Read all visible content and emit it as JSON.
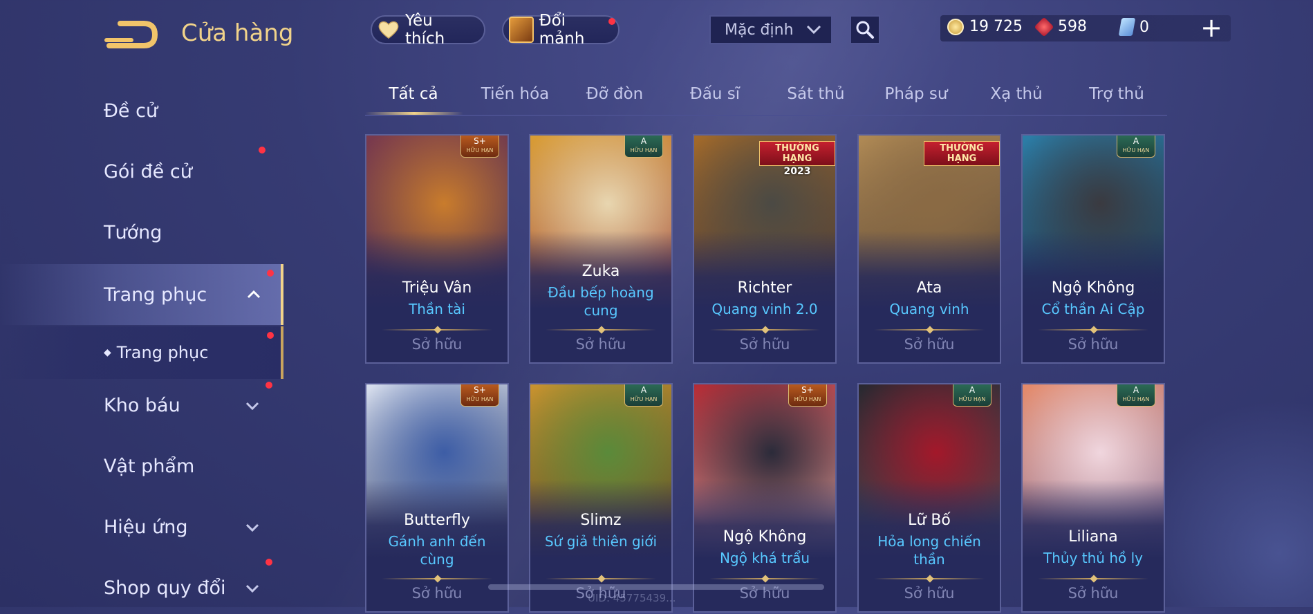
{
  "header": {
    "title": "Cửa hàng",
    "favorite_label": "Yêu thích",
    "exchange_label": "Đổi mảnh",
    "sort": {
      "selected": "Mặc định"
    }
  },
  "currencies": {
    "gold": "19 725",
    "quan_huy": "598",
    "voucher": "0"
  },
  "sidebar": {
    "items": [
      {
        "label": "Đề cử"
      },
      {
        "label": "Gói đề cử"
      },
      {
        "label": "Tướng"
      },
      {
        "label": "Trang phục"
      },
      {
        "label": "Trang phục"
      },
      {
        "label": "Kho báu"
      },
      {
        "label": "Vật phẩm"
      },
      {
        "label": "Hiệu ứng"
      },
      {
        "label": "Shop quy đổi"
      }
    ]
  },
  "tabs": [
    {
      "label": "Tất cả"
    },
    {
      "label": "Tiến hóa"
    },
    {
      "label": "Đỡ đòn"
    },
    {
      "label": "Đấu sĩ"
    },
    {
      "label": "Sát thủ"
    },
    {
      "label": "Pháp sư"
    },
    {
      "label": "Xạ thủ"
    },
    {
      "label": "Trợ thủ"
    }
  ],
  "cards": [
    {
      "hero": "Triệu Vân",
      "skin": "Thần tài",
      "status": "Sở hữu",
      "badge": "S+",
      "badge_sub": "HỮU HẠN",
      "art_colors": [
        "#7a3a4d",
        "#c97c2c",
        "#3c2f55"
      ]
    },
    {
      "hero": "Zuka",
      "skin": "Đầu bếp hoàng cung",
      "status": "Sở hữu",
      "badge": "A",
      "badge_sub": "HỮU HẠN",
      "art_colors": [
        "#d99d35",
        "#e8d6b0",
        "#8b2b4a"
      ]
    },
    {
      "hero": "Richter",
      "skin": "Quang vinh 2.0",
      "status": "Sở hữu",
      "banner": "THƯỜNG HẠNG",
      "banner_year": "2023",
      "art_colors": [
        "#a36a2a",
        "#4b4a44",
        "#2f2b3a"
      ]
    },
    {
      "hero": "Ata",
      "skin": "Quang vinh",
      "status": "Sở hữu",
      "banner": "THƯỜNG HẠNG",
      "art_colors": [
        "#b08a55",
        "#8a6a44",
        "#3a2e2c"
      ]
    },
    {
      "hero": "Ngộ Không",
      "skin": "Cổ thần Ai Cập",
      "status": "Sở hữu",
      "badge": "A",
      "badge_sub": "HỮU HẠN",
      "art_colors": [
        "#2c7ea8",
        "#3a3a40",
        "#1b2436"
      ]
    },
    {
      "hero": "Butterfly",
      "skin": "Gánh anh đến cùng",
      "status": "Sở hữu",
      "badge": "S+",
      "badge_sub": "HỮU HẠN",
      "art_colors": [
        "#d8dfee",
        "#3d5da6",
        "#1f2a4f"
      ]
    },
    {
      "hero": "Slimz",
      "skin": "Sứ giả thiên giới",
      "status": "Sở hữu",
      "badge": "A",
      "badge_sub": "HỮU HẠN",
      "art_colors": [
        "#c8932f",
        "#5a8a3a",
        "#3e2b1e"
      ]
    },
    {
      "hero": "Ngộ Không",
      "skin": "Ngộ khá trẩu",
      "status": "Sở hữu",
      "badge": "S+",
      "badge_sub": "HỮU HẠN",
      "art_colors": [
        "#b42b35",
        "#2b2b3a",
        "#d9d0c4"
      ]
    },
    {
      "hero": "Lữ Bố",
      "skin": "Hỏa long chiến thần",
      "status": "Sở hữu",
      "badge": "A",
      "badge_sub": "HỮU HẠN",
      "art_colors": [
        "#2a2830",
        "#a3182a",
        "#5c5660"
      ]
    },
    {
      "hero": "Liliana",
      "skin": "Thủy thủ hồ ly",
      "status": "Sở hữu",
      "badge": "A",
      "badge_sub": "HỮU HẠN",
      "art_colors": [
        "#e58a6a",
        "#f0d6de",
        "#6a6fb0"
      ]
    }
  ],
  "footer": {
    "uid": "UID: 45775439..."
  }
}
